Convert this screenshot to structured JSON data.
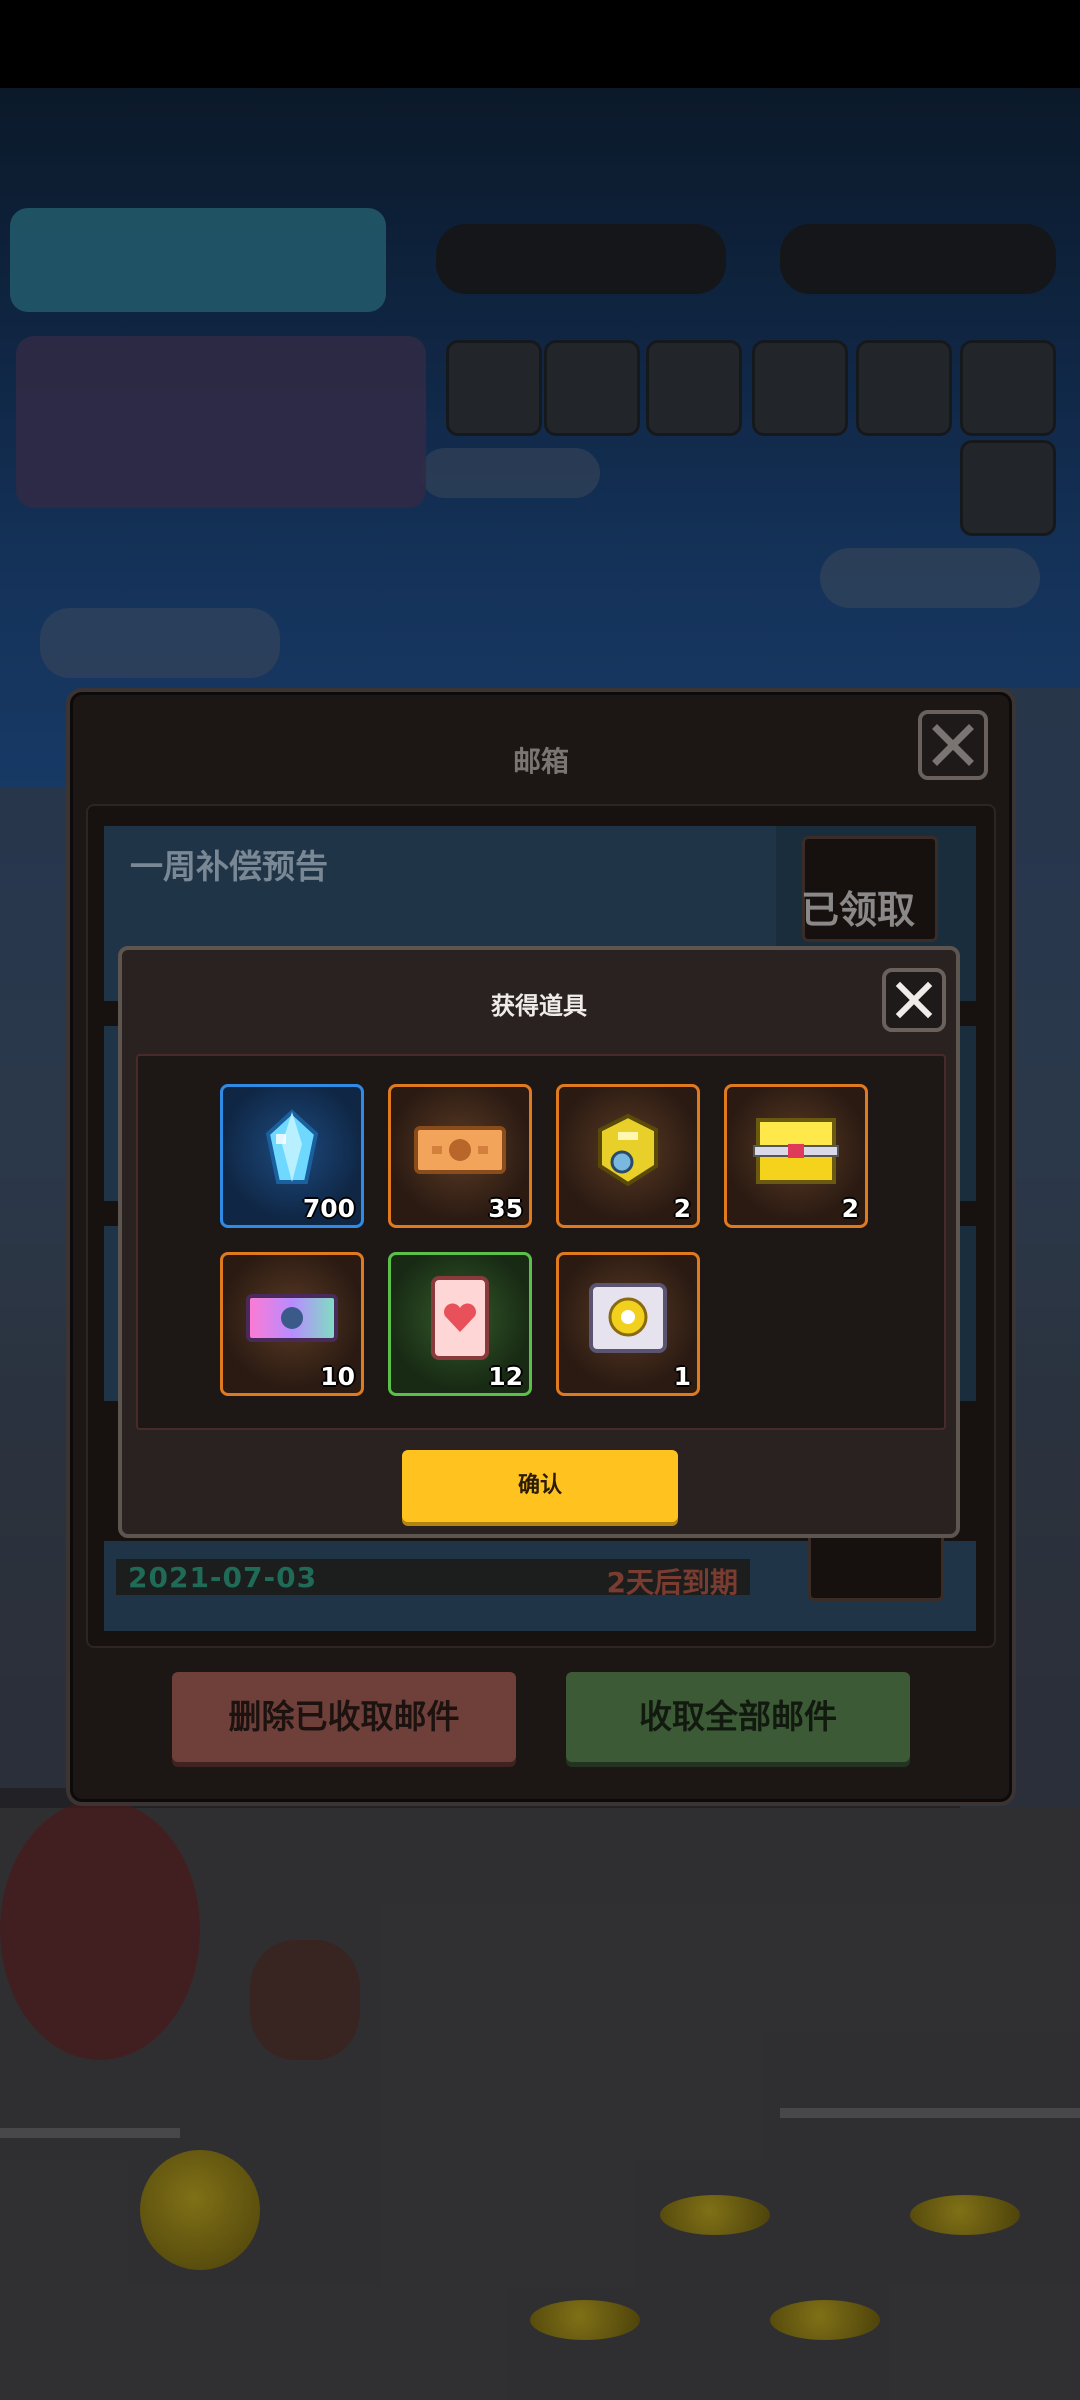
{
  "mailbox": {
    "title": "邮箱",
    "mail_title": "一周补偿预告",
    "claimed_label": "已领取",
    "date": "2021-07-03",
    "expiry": "2天后到期",
    "delete_button": "删除已收取邮件",
    "collect_all_button": "收取全部邮件"
  },
  "reward_popup": {
    "title": "获得道具",
    "confirm_button": "确认",
    "items": [
      {
        "icon": "diamond-crystal-icon",
        "quantity": "700",
        "frame": "blue"
      },
      {
        "icon": "orange-ticket-icon",
        "quantity": "35",
        "frame": "orange"
      },
      {
        "icon": "gold-helmet-icon",
        "quantity": "2",
        "frame": "orange"
      },
      {
        "icon": "yellow-chest-icon",
        "quantity": "2",
        "frame": "orange"
      },
      {
        "icon": "pink-ticket-icon",
        "quantity": "10",
        "frame": "orange"
      },
      {
        "icon": "heart-ticket-icon",
        "quantity": "12",
        "frame": "green"
      },
      {
        "icon": "silver-box-icon",
        "quantity": "1",
        "frame": "orange"
      }
    ]
  },
  "colors": {
    "confirm": "#ffc21f",
    "frame_orange": "#e07a1f",
    "frame_blue": "#2f8be6",
    "frame_green": "#5cbf4a"
  }
}
